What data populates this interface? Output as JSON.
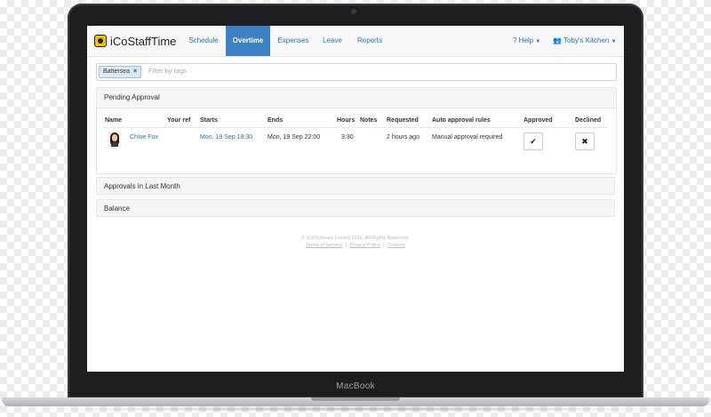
{
  "device": {
    "label": "MacBook"
  },
  "app": {
    "brand": "iCoStaffTime",
    "nav": [
      {
        "label": "Schedule",
        "active": false
      },
      {
        "label": "Overtime",
        "active": true
      },
      {
        "label": "Expenses",
        "active": false
      },
      {
        "label": "Leave",
        "active": false
      },
      {
        "label": "Reports",
        "active": false
      }
    ],
    "help": {
      "label": "? Help"
    },
    "account": {
      "label": "Toby's Kitchen"
    }
  },
  "filter": {
    "tag": "Battersea",
    "placeholder": "Filter by tags"
  },
  "pending": {
    "title": "Pending Approval",
    "columns": {
      "name": "Name",
      "ref": "Your ref",
      "starts": "Starts",
      "ends": "Ends",
      "hours": "Hours",
      "notes": "Notes",
      "requested": "Requested",
      "auto": "Auto approval rules",
      "approved": "Approved",
      "declined": "Declined"
    },
    "rows": [
      {
        "name": "Chloe Fox",
        "ref": "",
        "starts": "Mon, 19 Sep 18:30",
        "ends": "Mon, 19 Sep 22:00",
        "hours": "3:30",
        "notes": "",
        "requested": "2 hours ago",
        "auto": "Manual approval required"
      }
    ]
  },
  "sections": {
    "last_month": "Approvals in Last Month",
    "balance": "Balance"
  },
  "footer": {
    "copyright": "© iCoSoftware Limited 2016. All Rights Reserved.",
    "terms": "Terms of Service",
    "privacy": "Privacy Policy",
    "cookies": "Cookies",
    "separator": "|"
  },
  "icons": {
    "approve": "check-icon",
    "decline": "times-icon"
  },
  "colors": {
    "accent": "#3d80c4",
    "link": "#2a76b8"
  }
}
